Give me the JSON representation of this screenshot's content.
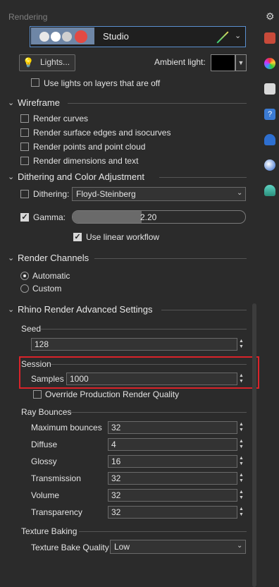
{
  "panel": {
    "title": "Rendering"
  },
  "environment": {
    "name": "Studio"
  },
  "lights": {
    "button_label": "Lights...",
    "ambient_label": "Ambient light:",
    "ambient_color": "#000000"
  },
  "use_lights_off": {
    "label": "Use lights on layers that are off",
    "checked": false
  },
  "wireframe": {
    "title": "Wireframe",
    "items": [
      {
        "label": "Render curves",
        "checked": false
      },
      {
        "label": "Render surface edges and isocurves",
        "checked": false
      },
      {
        "label": "Render points and point cloud",
        "checked": false
      },
      {
        "label": "Render dimensions and text",
        "checked": false
      }
    ]
  },
  "dithering": {
    "title": "Dithering and Color Adjustment",
    "label": "Dithering:",
    "value": "Floyd-Steinberg",
    "checked": false,
    "gamma_label": "Gamma:",
    "gamma_value": "2.20",
    "gamma_checked": true,
    "gamma_fill": 0.4,
    "linear_label": "Use linear workflow",
    "linear_checked": true
  },
  "channels": {
    "title": "Render Channels",
    "options": [
      "Automatic",
      "Custom"
    ],
    "selected": "Automatic"
  },
  "advanced": {
    "title": "Rhino Render Advanced Settings",
    "seed": {
      "group": "Seed",
      "value": "128"
    },
    "session": {
      "group": "Session",
      "samples_label": "Samples",
      "samples_value": "1000",
      "override_label": "Override Production Render Quality",
      "override_checked": false
    },
    "ray_bounces": {
      "group": "Ray Bounces",
      "rows": [
        {
          "label": "Maximum bounces",
          "value": "32"
        },
        {
          "label": "Diffuse",
          "value": "4"
        },
        {
          "label": "Glossy",
          "value": "16"
        },
        {
          "label": "Transmission",
          "value": "32"
        },
        {
          "label": "Volume",
          "value": "32"
        },
        {
          "label": "Transparency",
          "value": "32"
        }
      ]
    },
    "texture_baking": {
      "group": "Texture Baking",
      "quality_label": "Texture Bake Quality",
      "quality_value": "Low"
    }
  },
  "icons": {
    "settings": "gear-icon",
    "sidebar": [
      "layers-panel-icon",
      "color-wheel-icon",
      "display-panel-icon",
      "help-icon",
      "notifications-icon",
      "rendering-icon",
      "environment-icon"
    ]
  }
}
